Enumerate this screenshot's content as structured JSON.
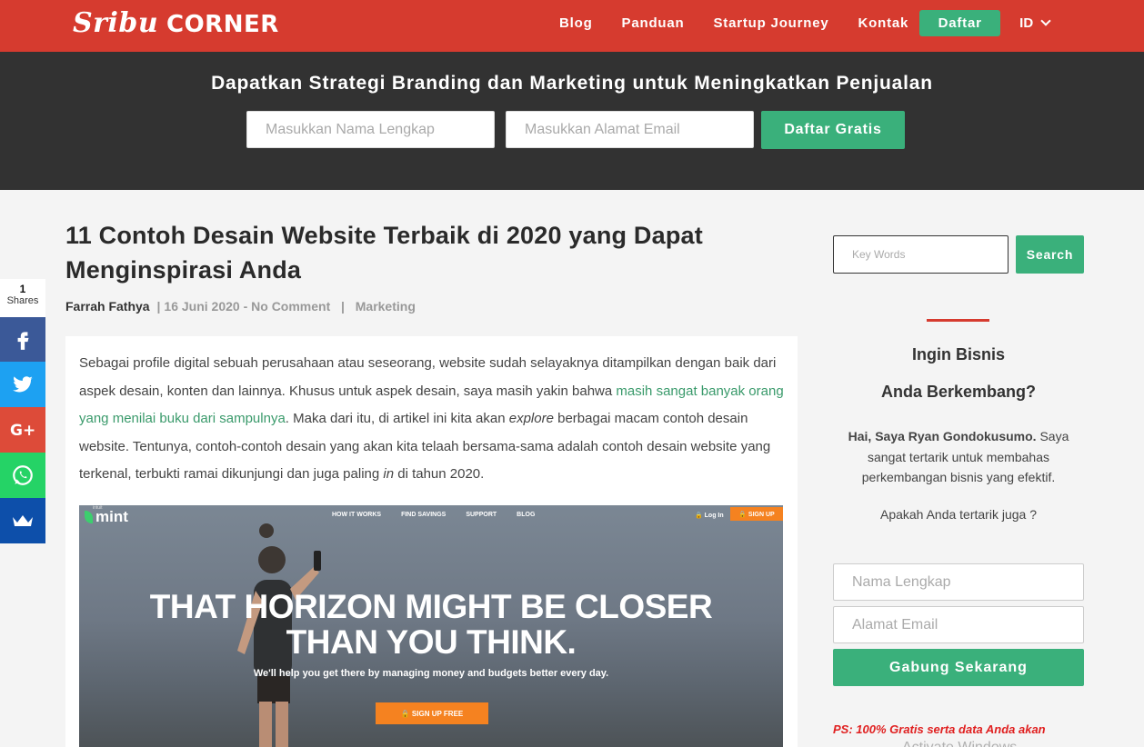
{
  "brand": {
    "logo_script": "Sribu",
    "logo_word": "CORNER"
  },
  "nav": {
    "links": [
      "Blog",
      "Panduan",
      "Startup Journey",
      "Kontak"
    ],
    "daftar_label": "Daftar",
    "lang": "ID"
  },
  "banner": {
    "title": "Dapatkan Strategi Branding dan Marketing untuk Meningkatkan Penjualan",
    "name_placeholder": "Masukkan Nama Lengkap",
    "email_placeholder": "Masukkan Alamat Email",
    "submit_label": "Daftar Gratis"
  },
  "article": {
    "title": "11 Contoh Desain Website Terbaik di 2020 yang Dapat Menginspirasi Anda",
    "author": "Farrah Fathya",
    "date": "16 Juni 2020",
    "dash": "-",
    "comments": "No Comment",
    "category": "Marketing",
    "p_part1": "Sebagai profile digital sebuah perusahaan atau seseorang, website sudah selayaknya ditampilkan dengan baik dari aspek desain, konten dan lainnya. Khusus untuk aspek desain, saya masih yakin bahwa ",
    "p_link": "masih sangat banyak orang yang menilai buku dari sampulnya",
    "p_part2": ". Maka dari itu, di artikel ini kita akan ",
    "p_em1": "explore",
    "p_part3": " berbagai macam contoh desain website. Tentunya, contoh-contoh desain yang akan kita telaah bersama-sama adalah contoh desain website yang terkenal, terbukti ramai dikunjungi dan juga paling ",
    "p_em2": "in",
    "p_part4": " di tahun 2020."
  },
  "hero": {
    "intuit": "intuit",
    "logo": "mint",
    "links": [
      "HOW IT WORKS",
      "FIND SAVINGS",
      "SUPPORT",
      "BLOG"
    ],
    "login": "🔒 Log In",
    "signup": "🔒 SIGN UP",
    "headline_1": "THAT HORIZON MIGHT BE CLOSER",
    "headline_2": "THAN YOU THINK.",
    "subline": "We'll help you get there by managing money and budgets better every day.",
    "cta": "🔒 SIGN UP FREE"
  },
  "share": {
    "count": "1",
    "label": "Shares",
    "buttons": [
      {
        "icon": "facebook-icon",
        "color": "#3b5998"
      },
      {
        "icon": "twitter-icon",
        "color": "#1da1f2"
      },
      {
        "icon": "google-plus-icon",
        "color": "#dd4b39"
      },
      {
        "icon": "whatsapp-icon",
        "color": "#25d366"
      },
      {
        "icon": "sumo-crown-icon",
        "color": "#0d4faa"
      }
    ]
  },
  "sidebar": {
    "search_placeholder": "Key Words",
    "search_label": "Search",
    "heading_1": "Ingin Bisnis",
    "heading_2": "Anda Berkembang?",
    "intro_bold": "Hai, Saya Ryan Gondokusumo.",
    "intro_rest": " Saya sangat tertarik untuk membahas perkembangan bisnis yang efektif.",
    "question": "Apakah Anda tertarik juga ?",
    "name_placeholder": "Nama Lengkap",
    "email_placeholder": "Alamat Email",
    "join_label": "Gabung Sekarang",
    "ps": "PS: 100% Gratis serta data Anda akan"
  },
  "watermark": "Activate Windows",
  "colors": {
    "brand_red": "#d63b2f",
    "accent_green": "#3ab07b",
    "banner_dark": "#323232",
    "mint_orange": "#f58220"
  }
}
